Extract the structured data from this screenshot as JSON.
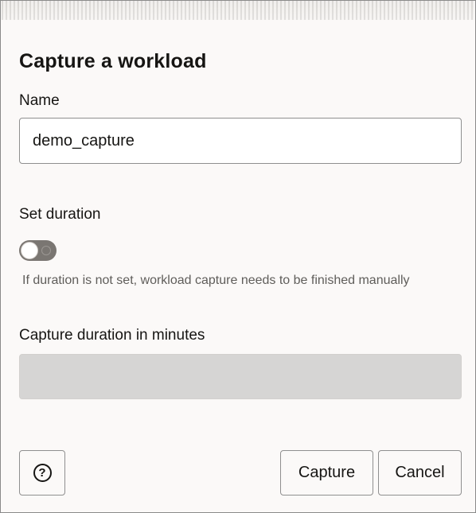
{
  "dialog": {
    "title": "Capture a workload",
    "name": {
      "label": "Name",
      "value": "demo_capture"
    },
    "set_duration": {
      "label": "Set duration",
      "enabled": false,
      "help_text": "If duration is not set, workload capture needs to be finished manually"
    },
    "capture_duration": {
      "label": "Capture duration in minutes",
      "value": "",
      "disabled": true
    },
    "footer": {
      "help_icon": "?",
      "capture_label": "Capture",
      "cancel_label": "Cancel"
    }
  }
}
